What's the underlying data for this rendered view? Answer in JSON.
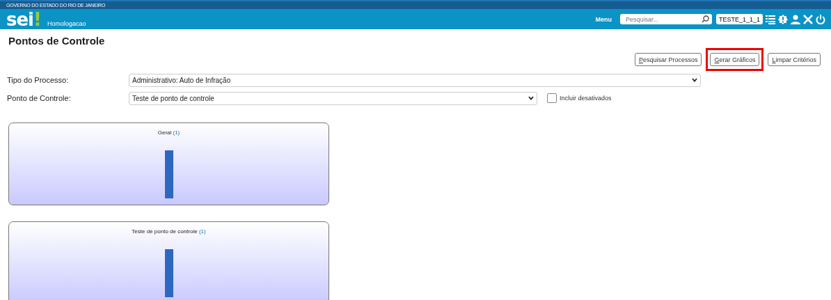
{
  "top_strip": {
    "text": "GOVERNO DO ESTADO DO RIO DE JANEIRO"
  },
  "header": {
    "logo": "sei",
    "logo_mark": "!",
    "environment": "Homologacao",
    "menu": "Menu",
    "search": {
      "placeholder": "Pesquisar..."
    },
    "unit": "TESTE_1_1_1"
  },
  "page_title": "Pontos de Controle",
  "buttons": [
    {
      "label": "Pesquisar Processos",
      "accesskey": true,
      "highlighted": false
    },
    {
      "label": "Gerar Gráficos",
      "accesskey": true,
      "highlighted": true
    },
    {
      "label": "Limpar Critérios",
      "accesskey": true,
      "highlighted": false
    }
  ],
  "fields": [
    {
      "label": "Tipo do Processo:",
      "value": "Administrativo: Auto de Infração",
      "kind": "wide"
    },
    {
      "label": "Ponto de Controle:",
      "value": "Teste de ponto de controle",
      "kind": "narrow",
      "checkbox": {
        "label": "Incluir desativados",
        "checked": false
      }
    }
  ],
  "charts": [
    {
      "title": "Geral",
      "count": "(1)"
    },
    {
      "title": "Teste de ponto de controle",
      "count": "(1)"
    }
  ]
}
